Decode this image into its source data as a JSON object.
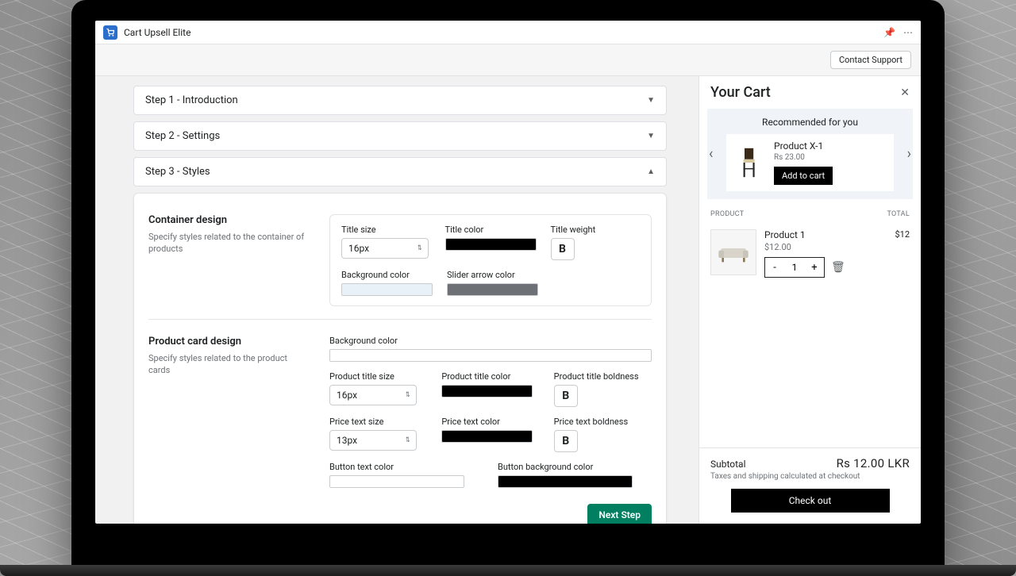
{
  "app": {
    "name": "Cart Upsell Elite"
  },
  "header": {
    "contact": "Contact Support"
  },
  "steps": {
    "s1": "Step 1 - Introduction",
    "s2": "Step 2 - Settings",
    "s3": "Step 3 - Styles"
  },
  "container": {
    "title": "Container design",
    "desc": "Specify styles related to the container of products",
    "labels": {
      "title_size": "Title size",
      "title_color": "Title color",
      "title_weight": "Title weight",
      "bg_color": "Background color",
      "slider_arrow": "Slider arrow color"
    },
    "values": {
      "title_size": "16px",
      "title_color": "#000000",
      "bg_color": "#e8f0f8",
      "slider_arrow": "#6d7175"
    }
  },
  "productCard": {
    "title": "Product card design",
    "desc": "Specify styles related to the product cards",
    "labels": {
      "bg_color": "Background color",
      "ptitle_size": "Product title size",
      "ptitle_color": "Product title color",
      "ptitle_bold": "Product title boldness",
      "price_size": "Price text size",
      "price_color": "Price text color",
      "price_bold": "Price text boldness",
      "btn_text_color": "Button text color",
      "btn_bg_color": "Button background color"
    },
    "values": {
      "ptitle_size": "16px",
      "ptitle_color": "#000000",
      "price_size": "13px",
      "price_color": "#000000",
      "bg_color": "#ffffff",
      "btn_text_color": "#ffffff",
      "btn_bg_color": "#000000"
    }
  },
  "nextStep": "Next Step",
  "cart": {
    "title": "Your Cart",
    "recommendTitle": "Recommended for you",
    "rec": {
      "name": "Product X-1",
      "price": "Rs 23.00",
      "cta": "Add to cart"
    },
    "cols": {
      "product": "PRODUCT",
      "total": "TOTAL"
    },
    "item": {
      "name": "Product 1",
      "price": "$12.00",
      "qty": "1",
      "total": "$12"
    },
    "subtotalLabel": "Subtotal",
    "subtotalAmount": "Rs 12.00 LKR",
    "taxNote": "Taxes and shipping calculated at checkout",
    "checkout": "Check out"
  },
  "bold": "B"
}
